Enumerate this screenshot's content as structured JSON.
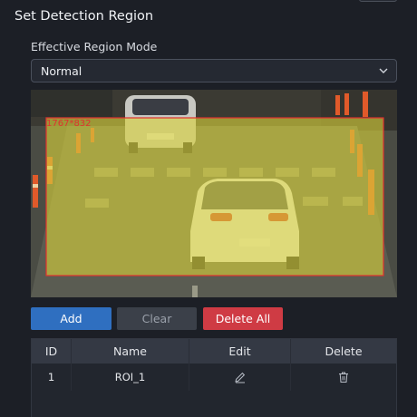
{
  "section_title": "Set Detection Region",
  "region_mode": {
    "label": "Effective Region Mode",
    "selected": "Normal"
  },
  "video": {
    "region_label": "1767*832"
  },
  "buttons": {
    "add": "Add",
    "clear": "Clear",
    "delete_all": "Delete All"
  },
  "table": {
    "headers": {
      "id": "ID",
      "name": "Name",
      "edit": "Edit",
      "delete": "Delete"
    },
    "rows": [
      {
        "id": "1",
        "name": "ROI_1"
      }
    ]
  },
  "colors": {
    "accent_blue": "#2f6fc0",
    "danger_red": "#cf3b44",
    "region_fill": "#d9d23a",
    "region_border": "#e0312f"
  },
  "icons": {
    "select_arrow": "chevron-down-icon",
    "edit": "pencil-icon",
    "delete": "trash-icon"
  }
}
